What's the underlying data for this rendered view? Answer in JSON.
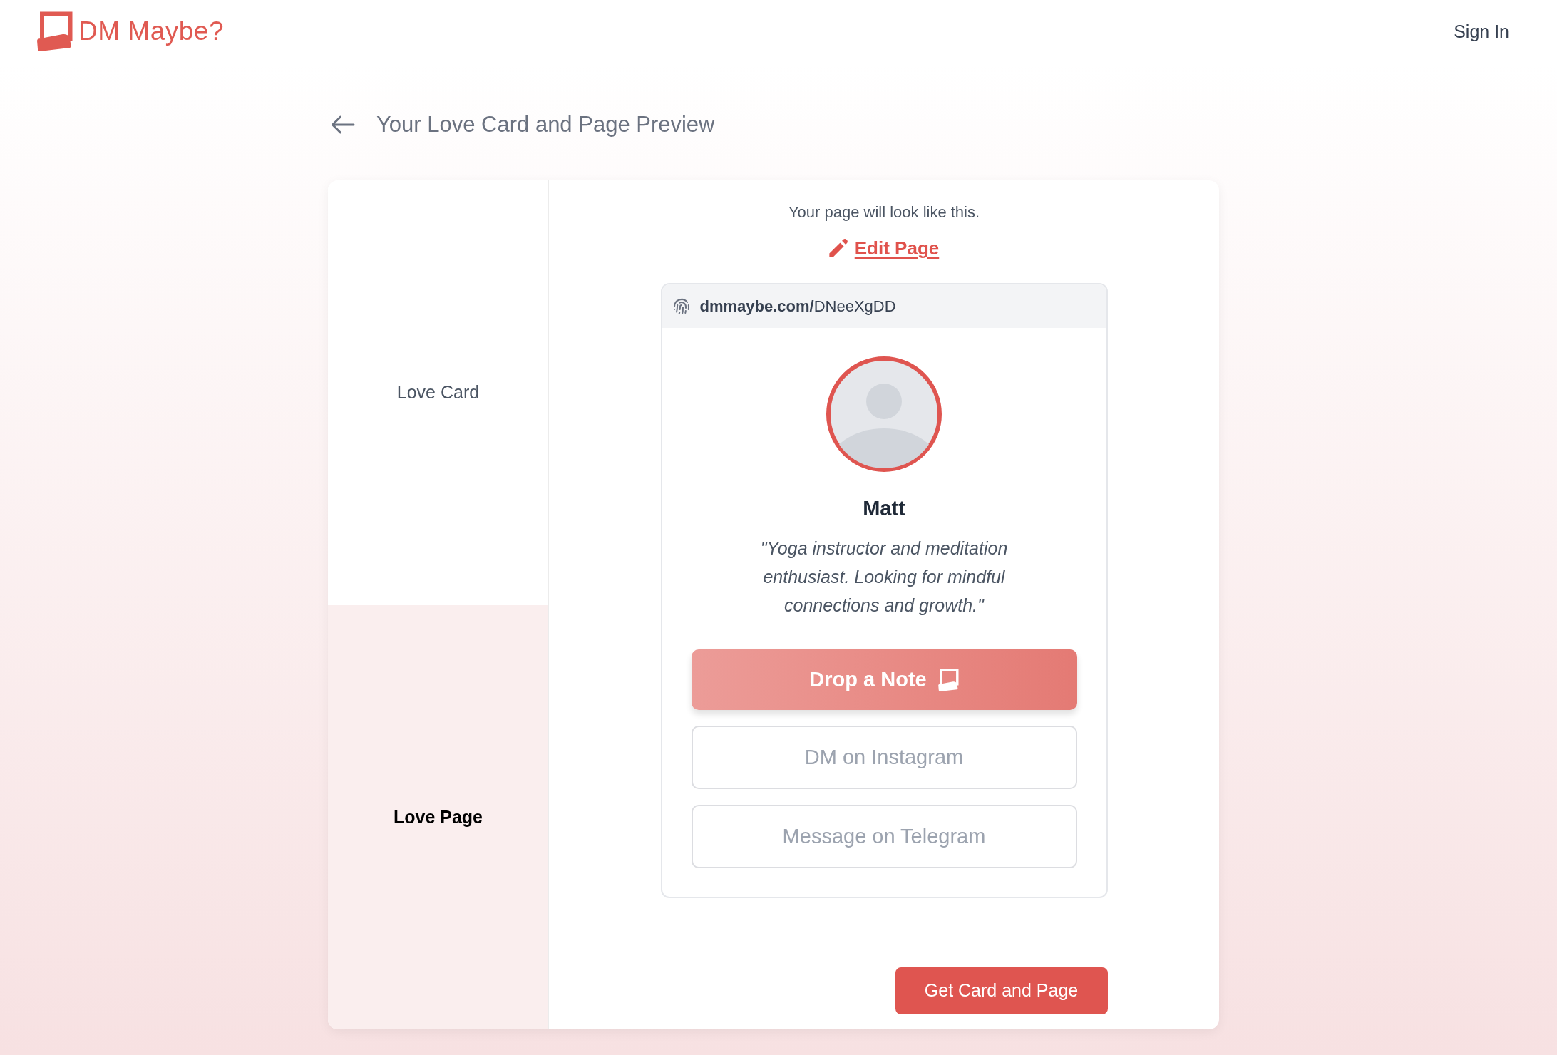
{
  "header": {
    "logo_text": "DM Maybe?",
    "sign_in": "Sign In"
  },
  "page_title": "Your Love Card and Page Preview",
  "tabs": [
    {
      "label": "Love Card",
      "selected": false
    },
    {
      "label": "Love Page",
      "selected": true
    }
  ],
  "preview": {
    "caption": "Your page will look like this.",
    "edit_link": "Edit Page",
    "url": "**dmmaybe.com/**DNeeXgDD",
    "profile": {
      "name": "Matt",
      "bio": "\"Yoga instructor and meditation enthusiast. Looking for mindful connections and growth.\""
    },
    "actions": [
      {
        "label": "Drop a Note",
        "kind": "primary"
      },
      {
        "label": "DM on Instagram",
        "kind": "outline"
      },
      {
        "label": "Message on Telegram",
        "kind": "outline"
      }
    ]
  },
  "submit_button": "Get Card and Page"
}
